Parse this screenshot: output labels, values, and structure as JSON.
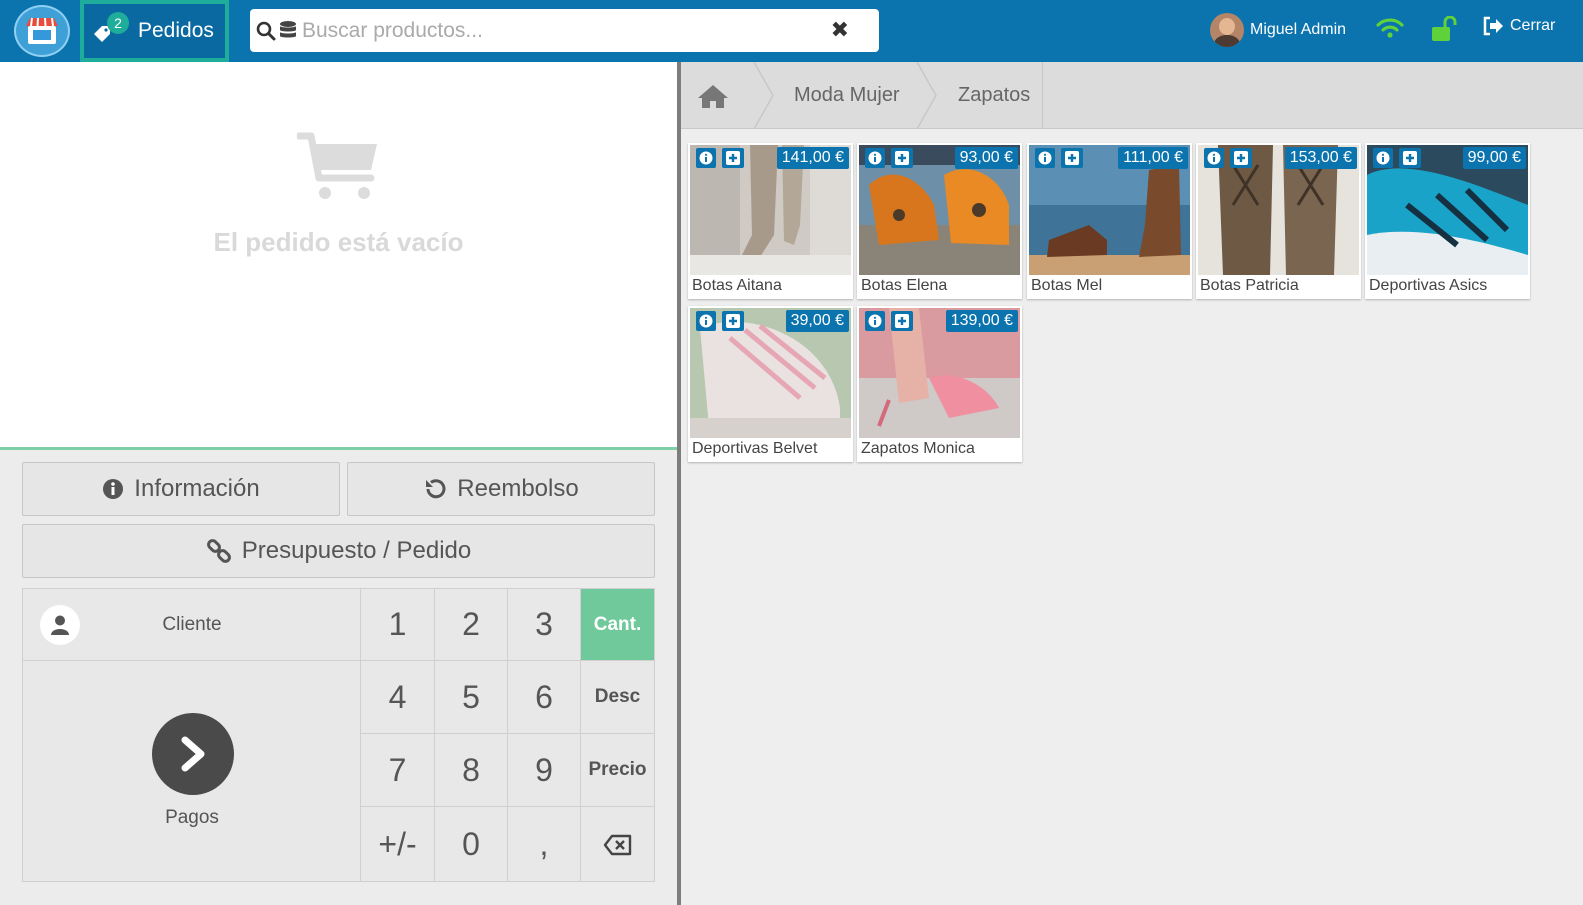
{
  "header": {
    "orders_label": "Pedidos",
    "orders_count": "2",
    "search_placeholder": "Buscar productos...",
    "user_name": "Miguel Admin",
    "logout_label": "Cerrar"
  },
  "cart": {
    "empty_message": "El pedido está vacío"
  },
  "actions": {
    "info_label": "Información",
    "refund_label": "Reembolso",
    "quote_label": "Presupuesto / Pedido"
  },
  "keypad": {
    "client_label": "Cliente",
    "payments_label": "Pagos",
    "keys": [
      "1",
      "2",
      "3",
      "4",
      "5",
      "6",
      "7",
      "8",
      "9",
      "+/-",
      "0",
      ","
    ],
    "modes": [
      "Cant.",
      "Desc",
      "Precio"
    ]
  },
  "breadcrumb": [
    "Moda Mujer",
    "Zapatos"
  ],
  "products": [
    {
      "name": "Botas Aitana",
      "price": "141,00 €"
    },
    {
      "name": "Botas Elena",
      "price": "93,00 €"
    },
    {
      "name": "Botas Mel",
      "price": "111,00 €"
    },
    {
      "name": "Botas Patricia",
      "price": "153,00 €"
    },
    {
      "name": "Deportivas Asics",
      "price": "99,00 €"
    },
    {
      "name": "Deportivas Belvet",
      "price": "39,00 €"
    },
    {
      "name": "Zapatos Monica",
      "price": "139,00 €"
    }
  ],
  "colors": {
    "primary": "#0b73ad",
    "accent_green": "#6fc99a",
    "teal": "#1dad9a",
    "wifi_green": "#5fd13b"
  }
}
